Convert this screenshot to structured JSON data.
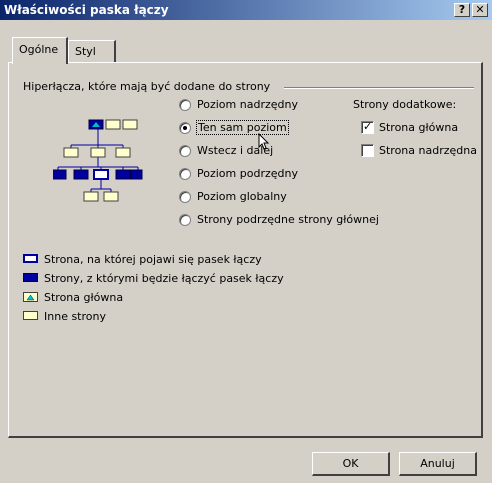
{
  "window": {
    "title": "Właściwości paska łączy",
    "help_label": "?",
    "close_label": "✕"
  },
  "tabs": [
    {
      "label": "Ogólne"
    },
    {
      "label": "Styl"
    }
  ],
  "group": {
    "label": "Hiperłącza, które mają być dodane do strony"
  },
  "radios": [
    {
      "label": "Poziom nadrzędny",
      "checked": false
    },
    {
      "label": "Ten sam poziom",
      "checked": true
    },
    {
      "label": "Wstecz i dalej",
      "checked": false
    },
    {
      "label": "Poziom podrzędny",
      "checked": false
    },
    {
      "label": "Poziom globalny",
      "checked": false
    },
    {
      "label": "Strony podrzędne strony głównej",
      "checked": false
    }
  ],
  "extra_pages": {
    "label": "Strony dodatkowe:",
    "items": [
      {
        "label": "Strona główna",
        "checked": true
      },
      {
        "label": "Strona nadrzędna",
        "checked": false
      }
    ]
  },
  "legend": [
    {
      "label": "Strona, na której pojawi się pasek łączy",
      "icon": "current-page-icon"
    },
    {
      "label": "Strony, z którymi będzie łączyć pasek łączy",
      "icon": "linked-pages-icon"
    },
    {
      "label": "Strona główna",
      "icon": "home-page-icon"
    },
    {
      "label": "Inne strony",
      "icon": "other-pages-icon"
    }
  ],
  "buttons": {
    "ok": "OK",
    "cancel": "Anuluj"
  },
  "colors": {
    "title_active": "#0a246a",
    "page_fill": "#ffffcc",
    "link_blue": "#0000a0",
    "home_cyan": "#00c0c0"
  }
}
